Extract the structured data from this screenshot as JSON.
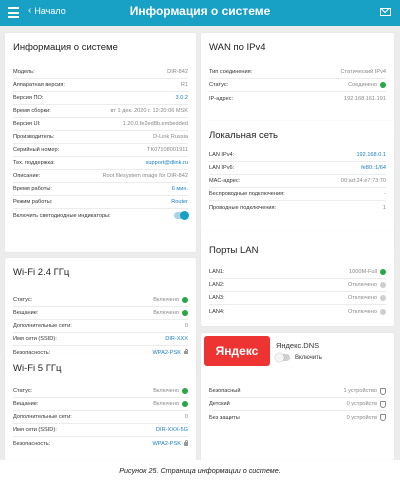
{
  "header": {
    "back_label": "Начало",
    "title": "Информация о системе"
  },
  "system_info": {
    "title": "Информация о системе",
    "rows": [
      {
        "label": "Модель:",
        "value": "DIR-842"
      },
      {
        "label": "Аппаратная версия:",
        "value": "R1"
      },
      {
        "label": "Версия ПО:",
        "value": "3.0.2"
      },
      {
        "label": "Время сборки:",
        "value": "вт 1 дек. 2020 г. 12:20:06 MSK"
      },
      {
        "label": "Версия UI:",
        "value": "1.20.0.fe2ed8b.embedded"
      },
      {
        "label": "Производитель:",
        "value": "D-Link Russia"
      },
      {
        "label": "Серийный номер:",
        "value": "TK07108001911"
      },
      {
        "label": "Тех. поддержка:",
        "value": "support@dlink.ru"
      },
      {
        "label": "Описание:",
        "value": "Root filesystem image for DIR-842"
      },
      {
        "label": "Время работы:",
        "value": "6 мин."
      },
      {
        "label": "Режим работы:",
        "value": "Router"
      },
      {
        "label": "Включить светодиодные индикаторы:",
        "value": ""
      }
    ]
  },
  "wan": {
    "title": "WAN по IPv4",
    "rows": [
      {
        "label": "Тип соединения:",
        "value": "Статический IPv4"
      },
      {
        "label": "Статус:",
        "value": "Соединено"
      },
      {
        "label": "IP-адрес:",
        "value": "192.168.161.191"
      }
    ]
  },
  "lan": {
    "title": "Локальная сеть",
    "rows": [
      {
        "label": "LAN IPv4:",
        "value": "192.168.0.1"
      },
      {
        "label": "LAN IPv6:",
        "value": "fe80::1/64"
      },
      {
        "label": "MAC-адрес:",
        "value": "00:ad:24:e7:73:70"
      },
      {
        "label": "Беспроводные подключения:",
        "value": "-"
      },
      {
        "label": "Проводные подключения:",
        "value": "1"
      }
    ]
  },
  "wifi24": {
    "title": "Wi-Fi 2.4 ГГц",
    "rows": [
      {
        "label": "Статус:",
        "value": "Включено"
      },
      {
        "label": "Вещание:",
        "value": "Включено"
      },
      {
        "label": "Дополнительные сети:",
        "value": "0"
      },
      {
        "label": "Имя сети (SSID):",
        "value": "DIR-XXX"
      },
      {
        "label": "Безопасность:",
        "value": "WPA2-PSK"
      }
    ]
  },
  "lan_ports": {
    "title": "Порты LAN",
    "rows": [
      {
        "label": "LAN1:",
        "value": "1000M-Full"
      },
      {
        "label": "LAN2:",
        "value": "Отключено"
      },
      {
        "label": "LAN3:",
        "value": "Отключено"
      },
      {
        "label": "LAN4:",
        "value": "Отключено"
      }
    ]
  },
  "wifi5": {
    "title": "Wi-Fi 5 ГГц",
    "rows": [
      {
        "label": "Статус:",
        "value": "Включено"
      },
      {
        "label": "Вещание:",
        "value": "Включено"
      },
      {
        "label": "Дополнительные сети:",
        "value": "0"
      },
      {
        "label": "Имя сети (SSID):",
        "value": "DIR-XXX-5G"
      },
      {
        "label": "Безопасность:",
        "value": "WPA2-PSK"
      }
    ]
  },
  "yandex": {
    "logo_text": "Яндекс",
    "title": "Яндекс.DNS",
    "toggle_label": "Включить",
    "rows": [
      {
        "label": "Безопасный",
        "value": "1 устройство"
      },
      {
        "label": "Детский",
        "value": "0 устройств"
      },
      {
        "label": "Без защиты",
        "value": "0 устройств"
      }
    ]
  },
  "caption": "Рисунок 25. Страница информации о системе.",
  "colors": {
    "accent": "#19a1c5",
    "status_green": "#27a844",
    "link": "#1a7fc0",
    "yandex_red": "#ee3333"
  }
}
